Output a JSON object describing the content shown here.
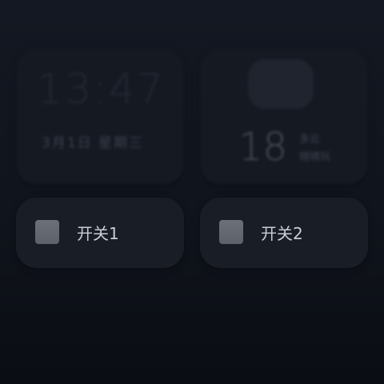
{
  "clock": {
    "time": "13:47",
    "date": "3月1日 星期三"
  },
  "weather": {
    "temperature": "18",
    "condition": "多云",
    "location": "晴晴玩"
  },
  "switches": [
    {
      "label": "开关1",
      "icon": "switch-square-icon"
    },
    {
      "label": "开关2",
      "icon": "switch-square-icon"
    }
  ]
}
